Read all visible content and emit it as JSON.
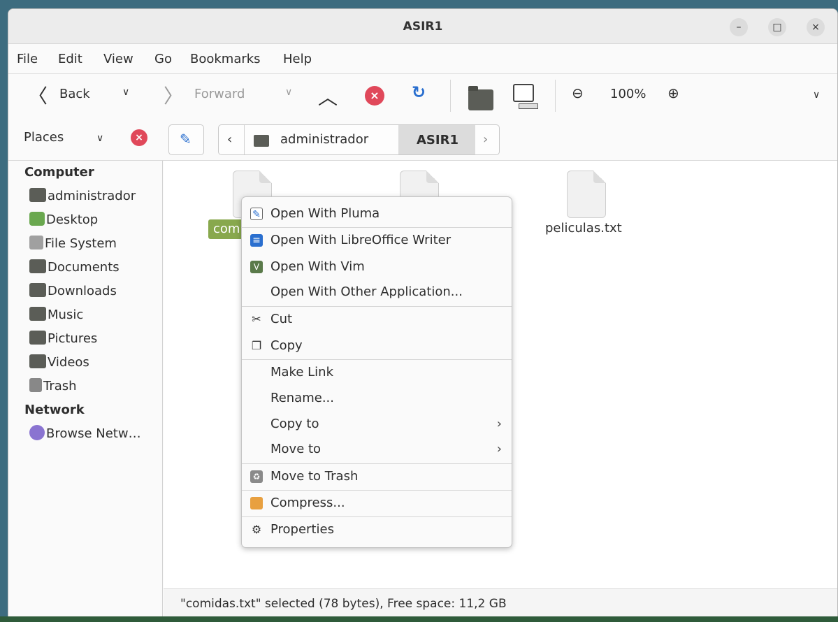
{
  "window": {
    "title": "ASIR1",
    "minimize": "–",
    "maximize": "□",
    "close": "×"
  },
  "menubar": [
    "File",
    "Edit",
    "View",
    "Go",
    "Bookmarks",
    "Help"
  ],
  "toolbar": {
    "back": "Back",
    "forward": "Forward",
    "zoom": "100%"
  },
  "location": {
    "places": "Places",
    "crumbs": [
      "administrador",
      "ASIR1"
    ]
  },
  "sidebar": {
    "computer_header": "Computer",
    "computer_items": [
      "administrador",
      "Desktop",
      "File System",
      "Documents",
      "Downloads",
      "Music",
      "Pictures",
      "Videos",
      "Trash"
    ],
    "network_header": "Network",
    "network_items": [
      "Browse Netw…"
    ]
  },
  "files": [
    {
      "name": "com",
      "selected": true
    },
    {
      "name": "",
      "selected": false
    },
    {
      "name": "peliculas.txt",
      "selected": false
    }
  ],
  "context_menu": {
    "items": [
      {
        "label": "Open With Pluma",
        "icon": "pluma-icon"
      },
      {
        "label": "Open With LibreOffice Writer",
        "icon": "writer-icon"
      },
      {
        "label": "Open With Vim",
        "icon": "vim-icon"
      },
      {
        "label": "Open With Other Application...",
        "icon": ""
      },
      {
        "label": "Cut",
        "icon": "scissors-icon"
      },
      {
        "label": "Copy",
        "icon": "copy-icon"
      },
      {
        "label": "Make Link",
        "icon": ""
      },
      {
        "label": "Rename...",
        "icon": ""
      },
      {
        "label": "Copy to",
        "icon": "",
        "submenu": true
      },
      {
        "label": "Move to",
        "icon": "",
        "submenu": true
      },
      {
        "label": "Move to Trash",
        "icon": "trash-icon"
      },
      {
        "label": "Compress...",
        "icon": "archive-icon"
      },
      {
        "label": "Properties",
        "icon": "gear-icon"
      }
    ]
  },
  "statusbar": {
    "text": "\"comidas.txt\" selected (78 bytes), Free space: 11,2 GB"
  },
  "colors": {
    "selection": "#88a84d",
    "accent_red": "#e0485a",
    "accent_blue": "#2a6fcf"
  }
}
